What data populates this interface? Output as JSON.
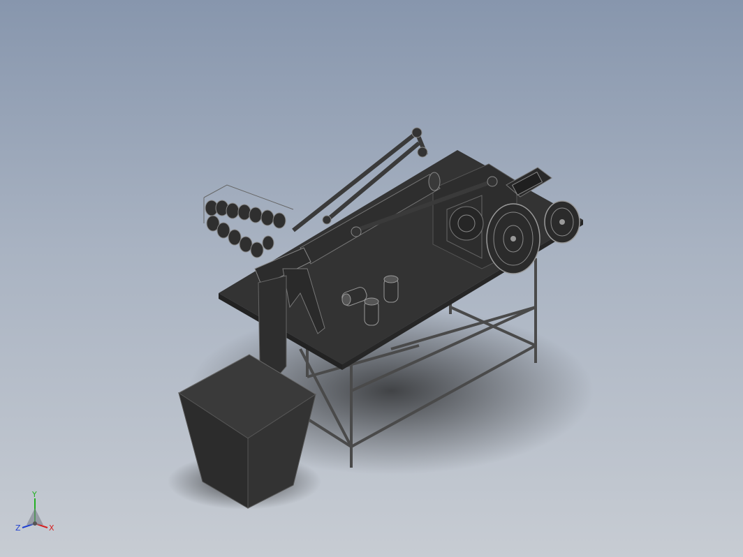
{
  "viewport": {
    "background_top": "#8796ad",
    "background_bottom": "#c7ccd3",
    "model_color": "#3a3a3a"
  },
  "triad": {
    "x_label": "X",
    "y_label": "Y",
    "z_label": "Z",
    "x_color": "#d42020",
    "y_color": "#22b022",
    "z_color": "#2040d0"
  }
}
